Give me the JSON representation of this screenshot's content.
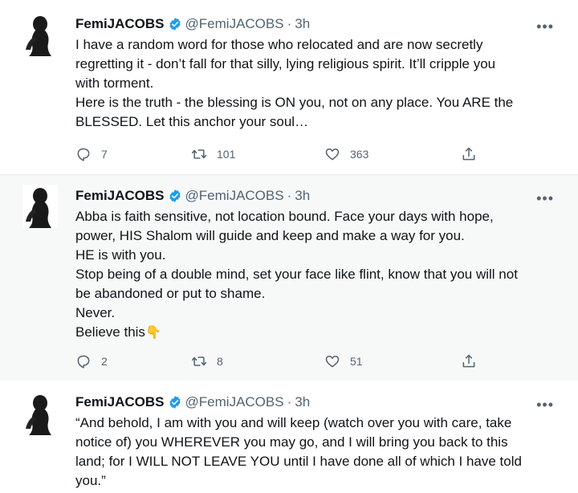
{
  "tweets": [
    {
      "name": "FemiJACOBS",
      "handle": "@FemiJACOBS",
      "separator": "·",
      "time": "3h",
      "more": "•••",
      "lines": [
        "I have a random word for those who relocated and are now secretly",
        "regretting it - don’t fall for that silly, lying religious spirit. It’ll cripple you",
        "with torment.",
        "Here is the truth - the blessing is ON you, not on any place. You ARE the",
        "BLESSED. Let this anchor your soul…"
      ],
      "replies": "7",
      "retweets": "101",
      "likes": "363"
    },
    {
      "name": "FemiJACOBS",
      "handle": "@FemiJACOBS",
      "separator": "·",
      "time": "3h",
      "more": "•••",
      "lines": [
        "Abba is faith sensitive, not location bound. Face your days with hope,",
        "power, HIS Shalom will guide and keep and make a way for you.",
        "HE is with you.",
        "Stop being of a double mind, set your face like flint, know that you will not",
        "be abandoned or put to shame.",
        "Never.",
        "Believe this"
      ],
      "emoji": "👇",
      "replies": "2",
      "retweets": "8",
      "likes": "51"
    },
    {
      "name": "FemiJACOBS",
      "handle": "@FemiJACOBS",
      "separator": "·",
      "time": "3h",
      "more": "•••",
      "lines": [
        "“And behold, I am with you and will keep (watch over you with care, take",
        "notice of) you WHEREVER you may go, and I will bring you back to this",
        "land; for I WILL NOT LEAVE YOU until I have done all of which I have told",
        "you.”"
      ]
    }
  ],
  "icons": {
    "avatar": "avatar-silhouette",
    "verified": "verified-badge-icon",
    "reply": "reply-icon",
    "retweet": "retweet-icon",
    "like": "heart-icon",
    "share": "share-icon"
  },
  "colors": {
    "verified": "#1d9bf0",
    "secondary_text": "#536471",
    "highlight_bg": "#f7f9f9"
  }
}
